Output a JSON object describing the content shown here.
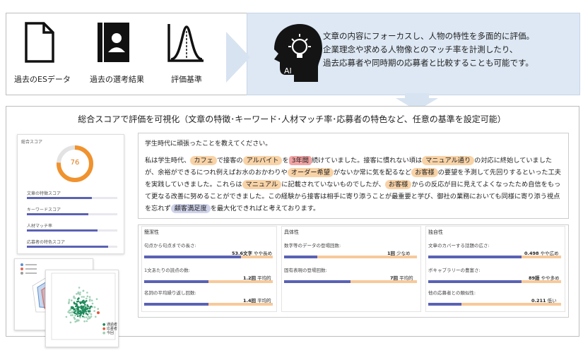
{
  "top": {
    "icons": [
      {
        "label": "過去のESデータ",
        "icon": "document-icon"
      },
      {
        "label": "過去の選考結果",
        "icon": "profile-book-icon"
      },
      {
        "label": "評価基準",
        "icon": "distribution-chart-icon"
      }
    ],
    "ai_label": "AI",
    "ai_description": [
      "文章の内容にフォーカスし、人物の特性を多面的に評価。",
      "企業理念や求める人物像とのマッチ率を計測したり、",
      "過去応募者や同時期の応募者と比較することも可能です。"
    ]
  },
  "main": {
    "title": "総合スコアで評価を可視化（文章の特徴･キーワード･人材マッチ率･応募者の特色など、任意の基準を設定可能）"
  },
  "score_card": {
    "title": "総合スコア",
    "score": "76",
    "score_fraction": 0.76,
    "bars": [
      {
        "label": "文章の特徴スコア",
        "fraction": 0.72
      },
      {
        "label": "キーワードスコア",
        "fraction": 0.68
      },
      {
        "label": "人材マッチ率",
        "fraction": 0.78
      },
      {
        "label": "応募者の特色スコア",
        "fraction": 0.9
      }
    ]
  },
  "essay": {
    "question": "学生時代に頑張ったことを教えてください。",
    "segments": {
      "s1": "私は学生時代、",
      "k1": "カフェ",
      "s2": "で接客の",
      "k2": "アルバイト",
      "s3": "を",
      "k3": "3年間",
      "s4": "続けていました。接客に慣れない頃は",
      "k4": "マニュアル通り",
      "s5": "の対応に終始していましたが、余裕ができるにつれ例えばお水のおかわりや",
      "k5": "オーダー希望",
      "s6": "がないか常に気を配るなど",
      "k6": "お客様",
      "s7": "の要望を予測して先回りするといった工夫を実践していきました。これらは",
      "k7": "マニュアル",
      "s8": "に記載されていないものでしたが、",
      "k8": "お客様",
      "s9": "からの反応が目に見えてよくなったため自信をもって更なる改善に努めることができました。この経験から接客は相手に寄り添うことが最重要と学び、御社の業務においても同様に寄り添う視点を忘れず",
      "k9": "顧客満足度",
      "s10": "を最大化できればと考えております。"
    }
  },
  "metrics": {
    "columns": [
      {
        "title": "簡潔性",
        "rows": [
          {
            "label": "句点から句点までの長さ:",
            "value": "53.6文字",
            "note": "やや長め",
            "fraction": 0.75
          },
          {
            "label": "1文あたりの読点の数:",
            "value": "1.2回",
            "note": "平均的",
            "fraction": 0.5
          },
          {
            "label": "名詞の平均繰り返し回数:",
            "value": "1.4回",
            "note": "平均的",
            "fraction": 0.5
          }
        ]
      },
      {
        "title": "具体性",
        "rows": [
          {
            "label": "数字等のデータの登場回数:",
            "value": "1回",
            "note": "少なめ",
            "fraction": 0.25
          },
          {
            "label": "固有表現の登場回数:",
            "value": "7回",
            "note": "平均的",
            "fraction": 0.5
          }
        ]
      },
      {
        "title": "独自性",
        "rows": [
          {
            "label": "文章のカバーする話題の広さ:",
            "value": "0.498",
            "note": "やや広め",
            "fraction": 0.7
          },
          {
            "label": "ボキャブラリーの豊富さ:",
            "value": "89語",
            "note": "やや多め",
            "fraction": 0.7
          },
          {
            "label": "他の応募者との類似性:",
            "value": "0.211",
            "note": "低い",
            "fraction": 0.25
          }
        ]
      }
    ]
  },
  "scatter_card": {
    "legend": [
      "通過者",
      "応募者",
      "今回"
    ],
    "colors": {
      "passed": "#1f8a5b",
      "applicant": "#9fd0b5",
      "current": "#e05a3a"
    }
  }
}
